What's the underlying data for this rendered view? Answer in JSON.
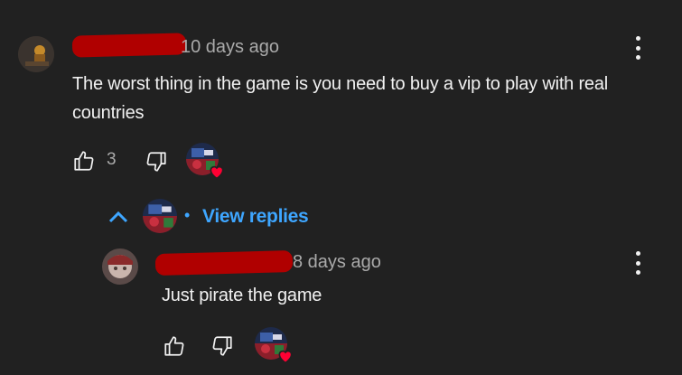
{
  "comment": {
    "handle_prefix": "@",
    "timestamp": "10 days ago",
    "text": "The worst thing in the game is you need to buy a vip to play with real countries",
    "like_count": "3"
  },
  "replies_toggle": {
    "label": "View replies",
    "separator": "•"
  },
  "reply": {
    "timestamp": "8 days ago",
    "text": "Just pirate the game"
  },
  "colors": {
    "background": "#212121",
    "text": "#f1f1f1",
    "secondary_text": "#aaaaaa",
    "link": "#3ea6ff",
    "heart": "#ff0033",
    "redaction": "#b00000"
  },
  "icons": [
    "thumbs-up-icon",
    "thumbs-down-icon",
    "more-vert-icon",
    "chevron-up-icon",
    "heart-icon"
  ]
}
